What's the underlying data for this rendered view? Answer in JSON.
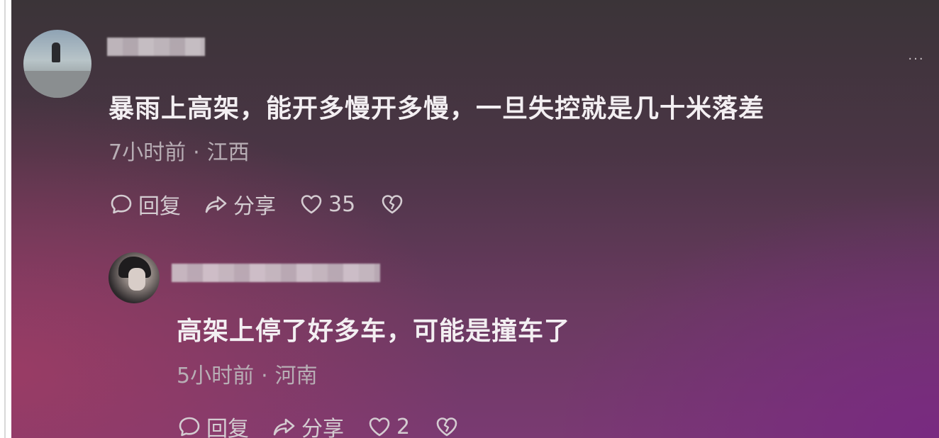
{
  "comments": [
    {
      "text": "暴雨上高架，能开多慢开多慢，一旦失控就是几十米落差",
      "time": "7小时前",
      "location": "江西",
      "reply_label": "回复",
      "share_label": "分享",
      "like_count": "35"
    },
    {
      "text": "高架上停了好多车，可能是撞车了",
      "time": "5小时前",
      "location": "河南",
      "reply_label": "回复",
      "share_label": "分享",
      "like_count": "2"
    }
  ],
  "meta_separator": "·",
  "more_icon": "···",
  "icons": [
    "more-icon",
    "comment-bubble-icon",
    "share-arrow-icon",
    "heart-icon",
    "broken-heart-icon"
  ],
  "colors": {
    "text": "#f3eff2",
    "meta": "#b8aeb5",
    "background_top": "#3b3438",
    "background_bottom": "#7a3a72"
  }
}
